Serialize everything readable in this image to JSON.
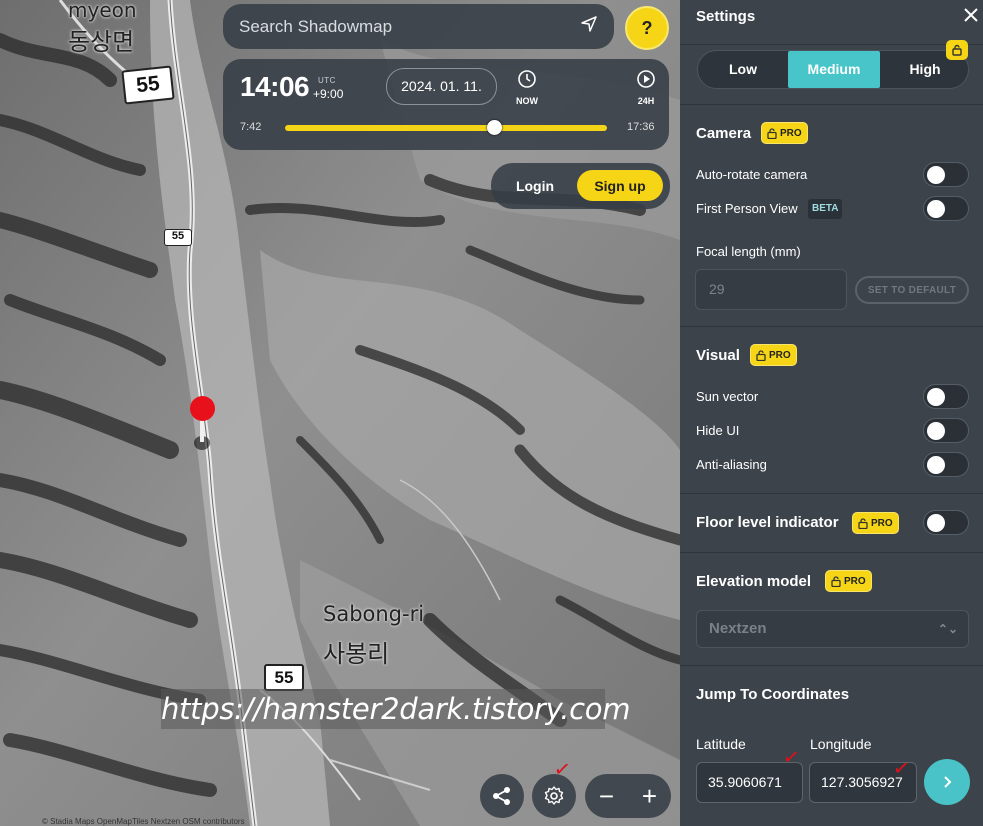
{
  "map": {
    "labels": {
      "top_en": "myeon",
      "top_kr": "동상면",
      "village_en": "Sabong-ri",
      "village_kr": "사봉리"
    },
    "route_shields": [
      "55",
      "55",
      "55"
    ],
    "attribution": "© Stadia Maps OpenMapTiles Nextzen OSM contributors",
    "watermark": "https://hamster2dark.tistory.com"
  },
  "search": {
    "placeholder": "Search Shadowmap"
  },
  "help_label": "?",
  "time": {
    "clock": "14:06",
    "utc_label": "UTC",
    "tz": "+9:00",
    "date": "2024. 01. 11.",
    "now_label": "NOW",
    "h24_label": "24H",
    "sunrise": "7:42",
    "sunset": "17:36",
    "slider_fraction": 0.65
  },
  "auth": {
    "login": "Login",
    "signup": "Sign up"
  },
  "settings": {
    "title": "Settings",
    "quality": {
      "options": [
        "Low",
        "Medium",
        "High"
      ],
      "selected": "Medium"
    },
    "pro_label": "PRO",
    "camera": {
      "title": "Camera",
      "auto_rotate": "Auto-rotate camera",
      "first_person": "First Person View",
      "beta": "BETA",
      "focal_label": "Focal length (mm)",
      "focal_value": "29",
      "set_default": "SET TO DEFAULT"
    },
    "visual": {
      "title": "Visual",
      "sun_vector": "Sun vector",
      "hide_ui": "Hide UI",
      "anti_aliasing": "Anti-aliasing"
    },
    "floor_level": "Floor level indicator",
    "elevation": {
      "title": "Elevation model",
      "value": "Nextzen"
    },
    "jump": {
      "title": "Jump To Coordinates",
      "lat_label": "Latitude",
      "lon_label": "Longitude",
      "lat_value": "35.9060671",
      "lon_value": "127.3056927"
    }
  },
  "colors": {
    "accent": "#49c3c7",
    "pro": "#f5d515",
    "pin": "#e8101a"
  }
}
